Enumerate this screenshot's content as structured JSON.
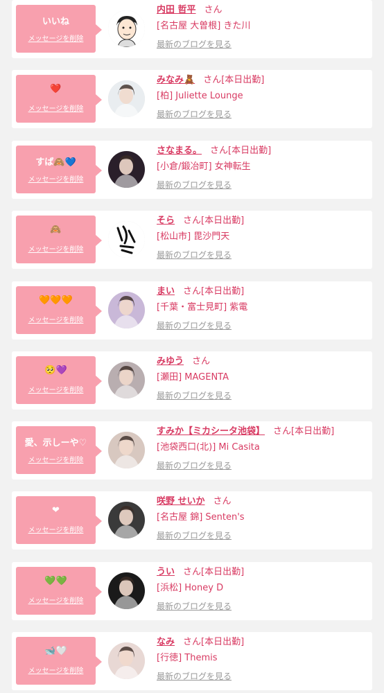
{
  "colors": {
    "bubble": "#f8a0ae",
    "name": "#d83a62",
    "blog_link": "#9a9a9a",
    "page_bg": "#f2f2f2"
  },
  "delete_label": "メッセージを削除",
  "blog_label": "最新のブログを見る",
  "items": [
    {
      "message": "いいね",
      "name": "内田 哲平",
      "suffix": "さん",
      "status": "",
      "shop": "[名古屋 大曽根] きた川",
      "avatar_bg": "#ffffff",
      "avatar_kind": "illustration"
    },
    {
      "message": "❤️",
      "name": "みなみ🧸",
      "suffix": "さん",
      "status": "[本日出勤]",
      "shop": "[柏] Juliette Lounge",
      "avatar_bg": "#e9edf0",
      "avatar_kind": "photo"
    },
    {
      "message": "すば🙈💙",
      "name": "さなまる。",
      "suffix": "さん",
      "status": "[本日出勤]",
      "shop": "[小倉/鍛冶町] 女神転生",
      "avatar_bg": "#2a1f2a",
      "avatar_kind": "photo"
    },
    {
      "message": "🙈",
      "name": "そら",
      "suffix": "さん",
      "status": "[本日出勤]",
      "shop": "[松山市] 毘沙門天",
      "avatar_bg": "#ffffff",
      "avatar_kind": "calligraphy"
    },
    {
      "message": "🧡🧡🧡",
      "name": "まい",
      "suffix": "さん",
      "status": "[本日出勤]",
      "shop": "[千葉・富士見町] 紫電",
      "avatar_bg": "#c9b8d8",
      "avatar_kind": "photo"
    },
    {
      "message": "🥺💜",
      "name": "みゆう",
      "suffix": "さん",
      "status": "",
      "shop": "[瀬田] MAGENTA",
      "avatar_bg": "#b9aeb0",
      "avatar_kind": "photo"
    },
    {
      "message": "愛、示しーや♡",
      "name": "すみか【ミカシータ池袋】",
      "suffix": "さん",
      "status": "[本日出勤]",
      "shop": "[池袋西口(北)] Mi Casita",
      "avatar_bg": "#d8c8c0",
      "avatar_kind": "photo"
    },
    {
      "message": "❤",
      "name": "咲野 せいか",
      "suffix": "さん",
      "status": "",
      "shop": "[名古屋 錦] Senten's",
      "avatar_bg": "#3a3a3a",
      "avatar_kind": "photo"
    },
    {
      "message": "💚💚",
      "name": "うい",
      "suffix": "さん",
      "status": "[本日出勤]",
      "shop": "[浜松] Honey D",
      "avatar_bg": "#1a1a1a",
      "avatar_kind": "photo"
    },
    {
      "message": "🐋🤍",
      "name": "なみ",
      "suffix": "さん",
      "status": "[本日出勤]",
      "shop": "[行徳] Themis",
      "avatar_bg": "#e8d8d4",
      "avatar_kind": "photo"
    }
  ]
}
